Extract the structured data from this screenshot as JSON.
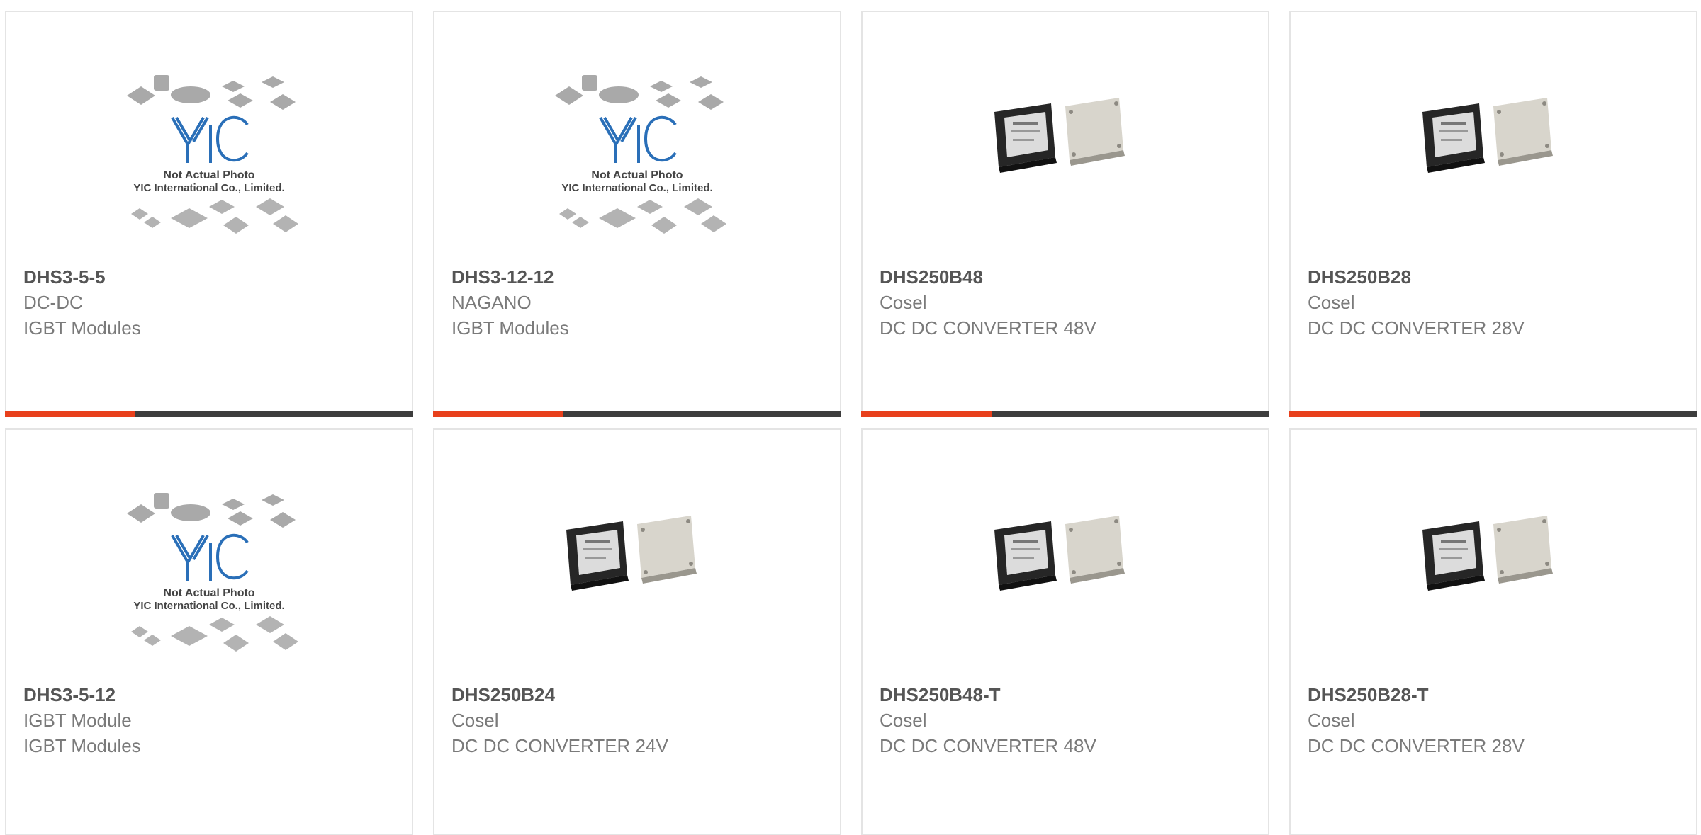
{
  "accent_color": "#e8401c",
  "bar_color": "#3d3d3d",
  "placeholder_text": {
    "line1": "Not Actual Photo",
    "line2": "YIC International Co., Limited."
  },
  "cards": [
    {
      "part": "DHS3-5-5",
      "line1": "DC-DC",
      "line2": "IGBT Modules",
      "image": "yic-placeholder-image"
    },
    {
      "part": "DHS3-12-12",
      "line1": "NAGANO",
      "line2": "IGBT Modules",
      "image": "yic-placeholder-image"
    },
    {
      "part": "DHS250B48",
      "line1": "Cosel",
      "line2": "DC DC CONVERTER 48V",
      "image": "dc-converter-modules-image"
    },
    {
      "part": "DHS250B28",
      "line1": "Cosel",
      "line2": "DC DC CONVERTER 28V",
      "image": "dc-converter-modules-image"
    },
    {
      "part": "DHS3-5-12",
      "line1": "IGBT Module",
      "line2": "IGBT Modules",
      "image": "yic-placeholder-image"
    },
    {
      "part": "DHS250B24",
      "line1": "Cosel",
      "line2": "DC DC CONVERTER 24V",
      "image": "dc-converter-modules-image"
    },
    {
      "part": "DHS250B48-T",
      "line1": "Cosel",
      "line2": "DC DC CONVERTER 48V",
      "image": "dc-converter-modules-image"
    },
    {
      "part": "DHS250B28-T",
      "line1": "Cosel",
      "line2": "DC DC CONVERTER 28V",
      "image": "dc-converter-modules-image"
    }
  ]
}
